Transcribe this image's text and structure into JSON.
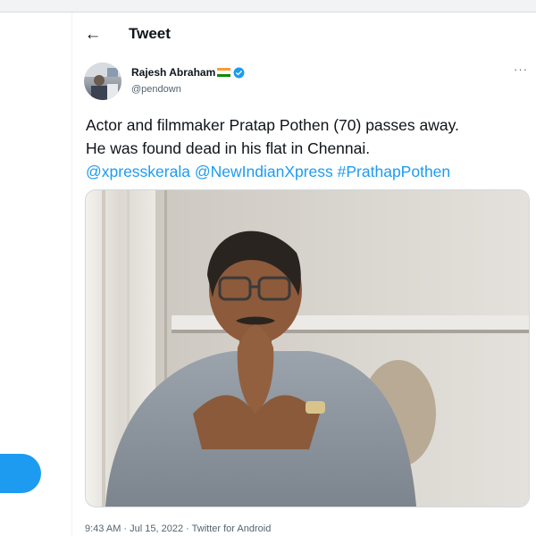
{
  "header": {
    "title": "Tweet",
    "back_icon": "arrow-left-icon"
  },
  "tweet": {
    "author": {
      "name": "Rajesh Abraham",
      "handle": "@pendown",
      "flag_icon": "india-flag-icon",
      "verified_icon": "verified-badge-icon"
    },
    "more_icon": "more-horizontal-icon",
    "text": {
      "line1": "Actor and filmmaker Pratap Pothen (70) passes away.",
      "line2": "He was found dead in his flat in Chennai.",
      "mention1": "@xpresskerala",
      "mention2": "@NewIndianXpress",
      "hashtag": "#PrathapPothen"
    },
    "meta": {
      "time": "9:43 AM",
      "sep1": " · ",
      "date": "Jul 15, 2022",
      "sep2": " · ",
      "source": "Twitter for Android"
    }
  },
  "colors": {
    "accent": "#1d9bf0",
    "text": "#0f1419",
    "secondary": "#536471"
  }
}
